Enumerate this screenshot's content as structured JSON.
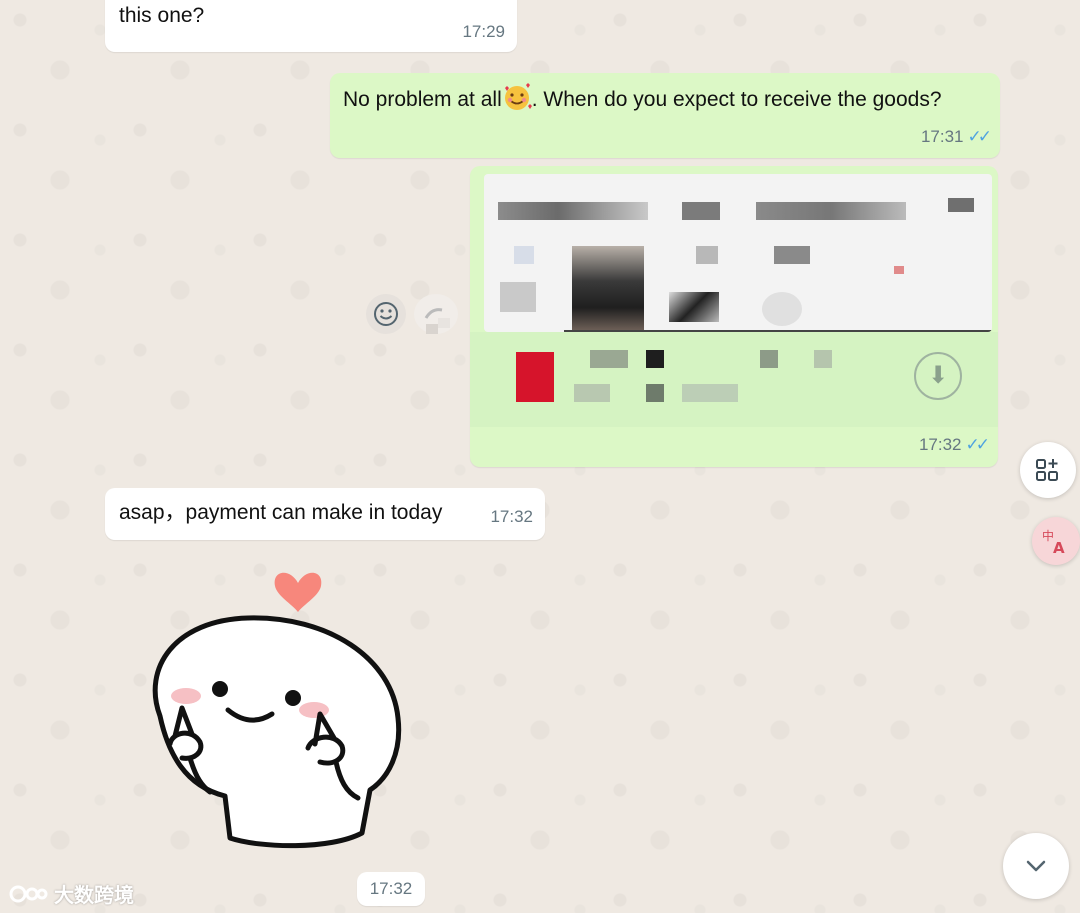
{
  "messages": [
    {
      "text": "this one?",
      "time": "17:29"
    },
    {
      "text_before": "No problem at all",
      "text_after": ". When do you expect to receive the goods?",
      "time": "17:31"
    },
    {
      "time": "17:32"
    },
    {
      "text": "asap，payment can make in today",
      "time": "17:32"
    },
    {
      "time": "17:32"
    }
  ],
  "icons": {
    "emoji_in_text": "smiling-face-with-hearts-icon",
    "read_receipt": "double-check-icon",
    "react": "smiley-face-icon",
    "forward": "forward-icon",
    "download": "download-arrow-icon",
    "apps": "apps-grid-plus-icon",
    "translate": "translate-icon",
    "scroll_down": "chevron-down-icon",
    "heart": "heart-icon"
  },
  "colors": {
    "incoming_bubble": "#ffffff",
    "outgoing_bubble": "#dcf8c6",
    "read_tick": "#4fa3e0",
    "chat_background": "#efe9e2"
  },
  "watermark": {
    "text": "大数跨境"
  }
}
